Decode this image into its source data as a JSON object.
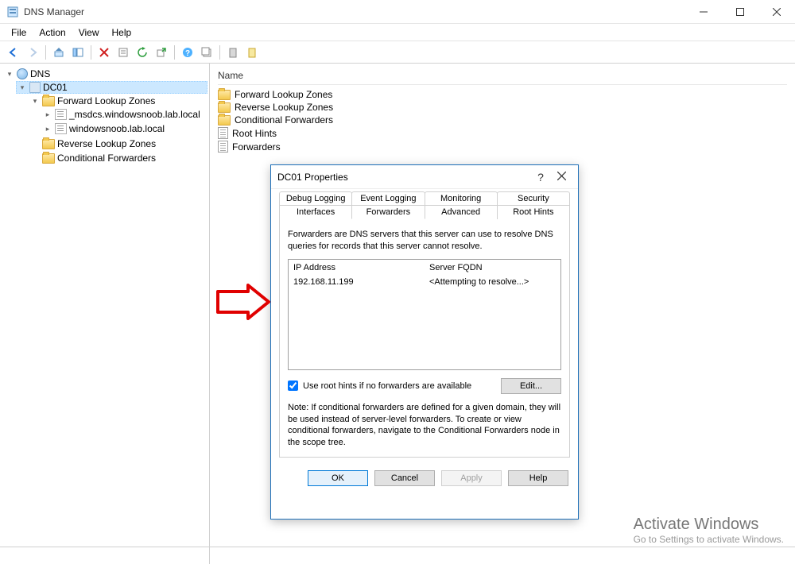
{
  "window": {
    "title": "DNS Manager"
  },
  "menu": {
    "file": "File",
    "action": "Action",
    "view": "View",
    "help": "Help"
  },
  "tree": {
    "root": "DNS",
    "server": "DC01",
    "flz": "Forward Lookup Zones",
    "zone1": "_msdcs.windowsnoob.lab.local",
    "zone2": "windowsnoob.lab.local",
    "rlz": "Reverse Lookup Zones",
    "cf": "Conditional Forwarders"
  },
  "content": {
    "header": "Name",
    "items": [
      "Forward Lookup Zones",
      "Reverse Lookup Zones",
      "Conditional Forwarders",
      "Root Hints",
      "Forwarders"
    ]
  },
  "dialog": {
    "title": "DC01 Properties",
    "tabs_top": [
      "Debug Logging",
      "Event Logging",
      "Monitoring",
      "Security"
    ],
    "tabs_bottom": [
      "Interfaces",
      "Forwarders",
      "Advanced",
      "Root Hints"
    ],
    "active_tab": "Forwarders",
    "desc": "Forwarders are DNS servers that this server can use to resolve DNS queries for records that this server cannot resolve.",
    "col_ip": "IP Address",
    "col_fqdn": "Server FQDN",
    "row_ip": "192.168.11.199",
    "row_fqdn": "<Attempting to resolve...>",
    "use_root_hints": "Use root hints if no forwarders are available",
    "edit": "Edit...",
    "note": "Note: If conditional forwarders are defined for a given domain, they will be used instead of server-level forwarders. To create or view conditional forwarders, navigate to the Conditional Forwarders node in the scope tree.",
    "ok": "OK",
    "cancel": "Cancel",
    "apply": "Apply",
    "help": "Help"
  },
  "watermark": {
    "line1": "Activate Windows",
    "line2": "Go to Settings to activate Windows."
  }
}
